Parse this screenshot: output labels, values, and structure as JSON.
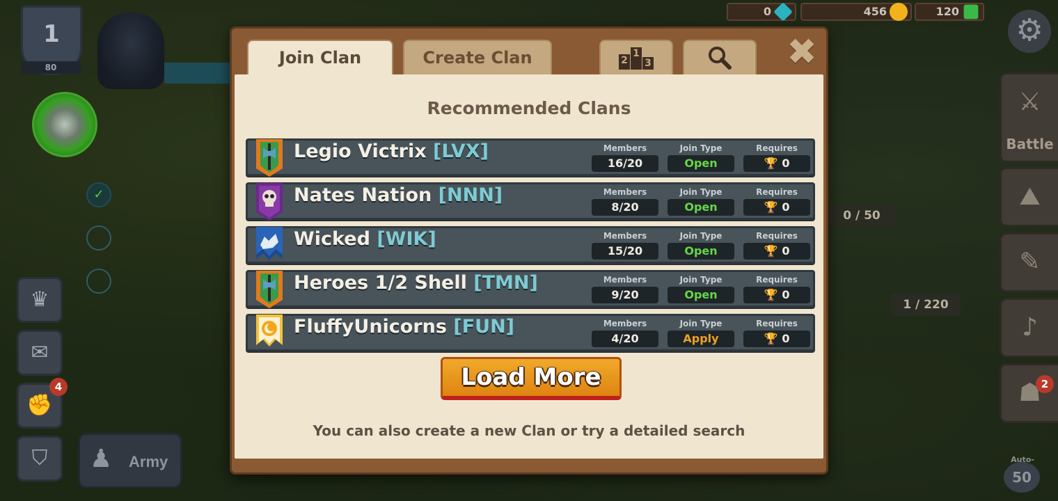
{
  "hud": {
    "level": "1",
    "xp": "80",
    "currencies": [
      {
        "value": "0",
        "icon": "crystal-icon",
        "color": "#2bb3c0"
      },
      {
        "value": "456",
        "icon": "gold-coin-icon",
        "color": "#f2b21c"
      },
      {
        "value": "120",
        "icon": "emerald-icon",
        "color": "#3bb84a"
      }
    ],
    "army_label": "Army",
    "quest_badge": "4",
    "battle_label": "Battle",
    "right_badge": "2",
    "storage_capacity": "0 / 50",
    "cart_capacity": "1 / 220",
    "autospin_label": "Auto-Spin",
    "autospin_value": "50"
  },
  "modal": {
    "tabs": {
      "join": "Join Clan",
      "create": "Create Clan",
      "podium": [
        "2",
        "1",
        "3"
      ]
    },
    "heading": "Recommended Clans",
    "column_labels": {
      "members": "Members",
      "join_type": "Join Type",
      "requires": "Requires"
    },
    "clans": [
      {
        "name": "Legio Victrix",
        "tag": "[LVX]",
        "members": "16/20",
        "join_type": "Open",
        "requires": "0",
        "banner": "green-axe-banner-icon"
      },
      {
        "name": "Nates Nation",
        "tag": "[NNN]",
        "members": "8/20",
        "join_type": "Open",
        "requires": "0",
        "banner": "purple-skull-banner-icon"
      },
      {
        "name": "Wicked",
        "tag": "[WIK]",
        "members": "15/20",
        "join_type": "Open",
        "requires": "0",
        "banner": "blue-wolf-banner-icon"
      },
      {
        "name": "Heroes 1/2 Shell",
        "tag": "[TMN]",
        "members": "9/20",
        "join_type": "Open",
        "requires": "0",
        "banner": "green-axe-banner-icon"
      },
      {
        "name": "FluffyUnicorns",
        "tag": "[FUN]",
        "members": "4/20",
        "join_type": "Apply",
        "requires": "0",
        "banner": "sun-moon-banner-icon"
      }
    ],
    "load_more": "Load More",
    "footer": "You can also create a new Clan or try a detailed search"
  }
}
